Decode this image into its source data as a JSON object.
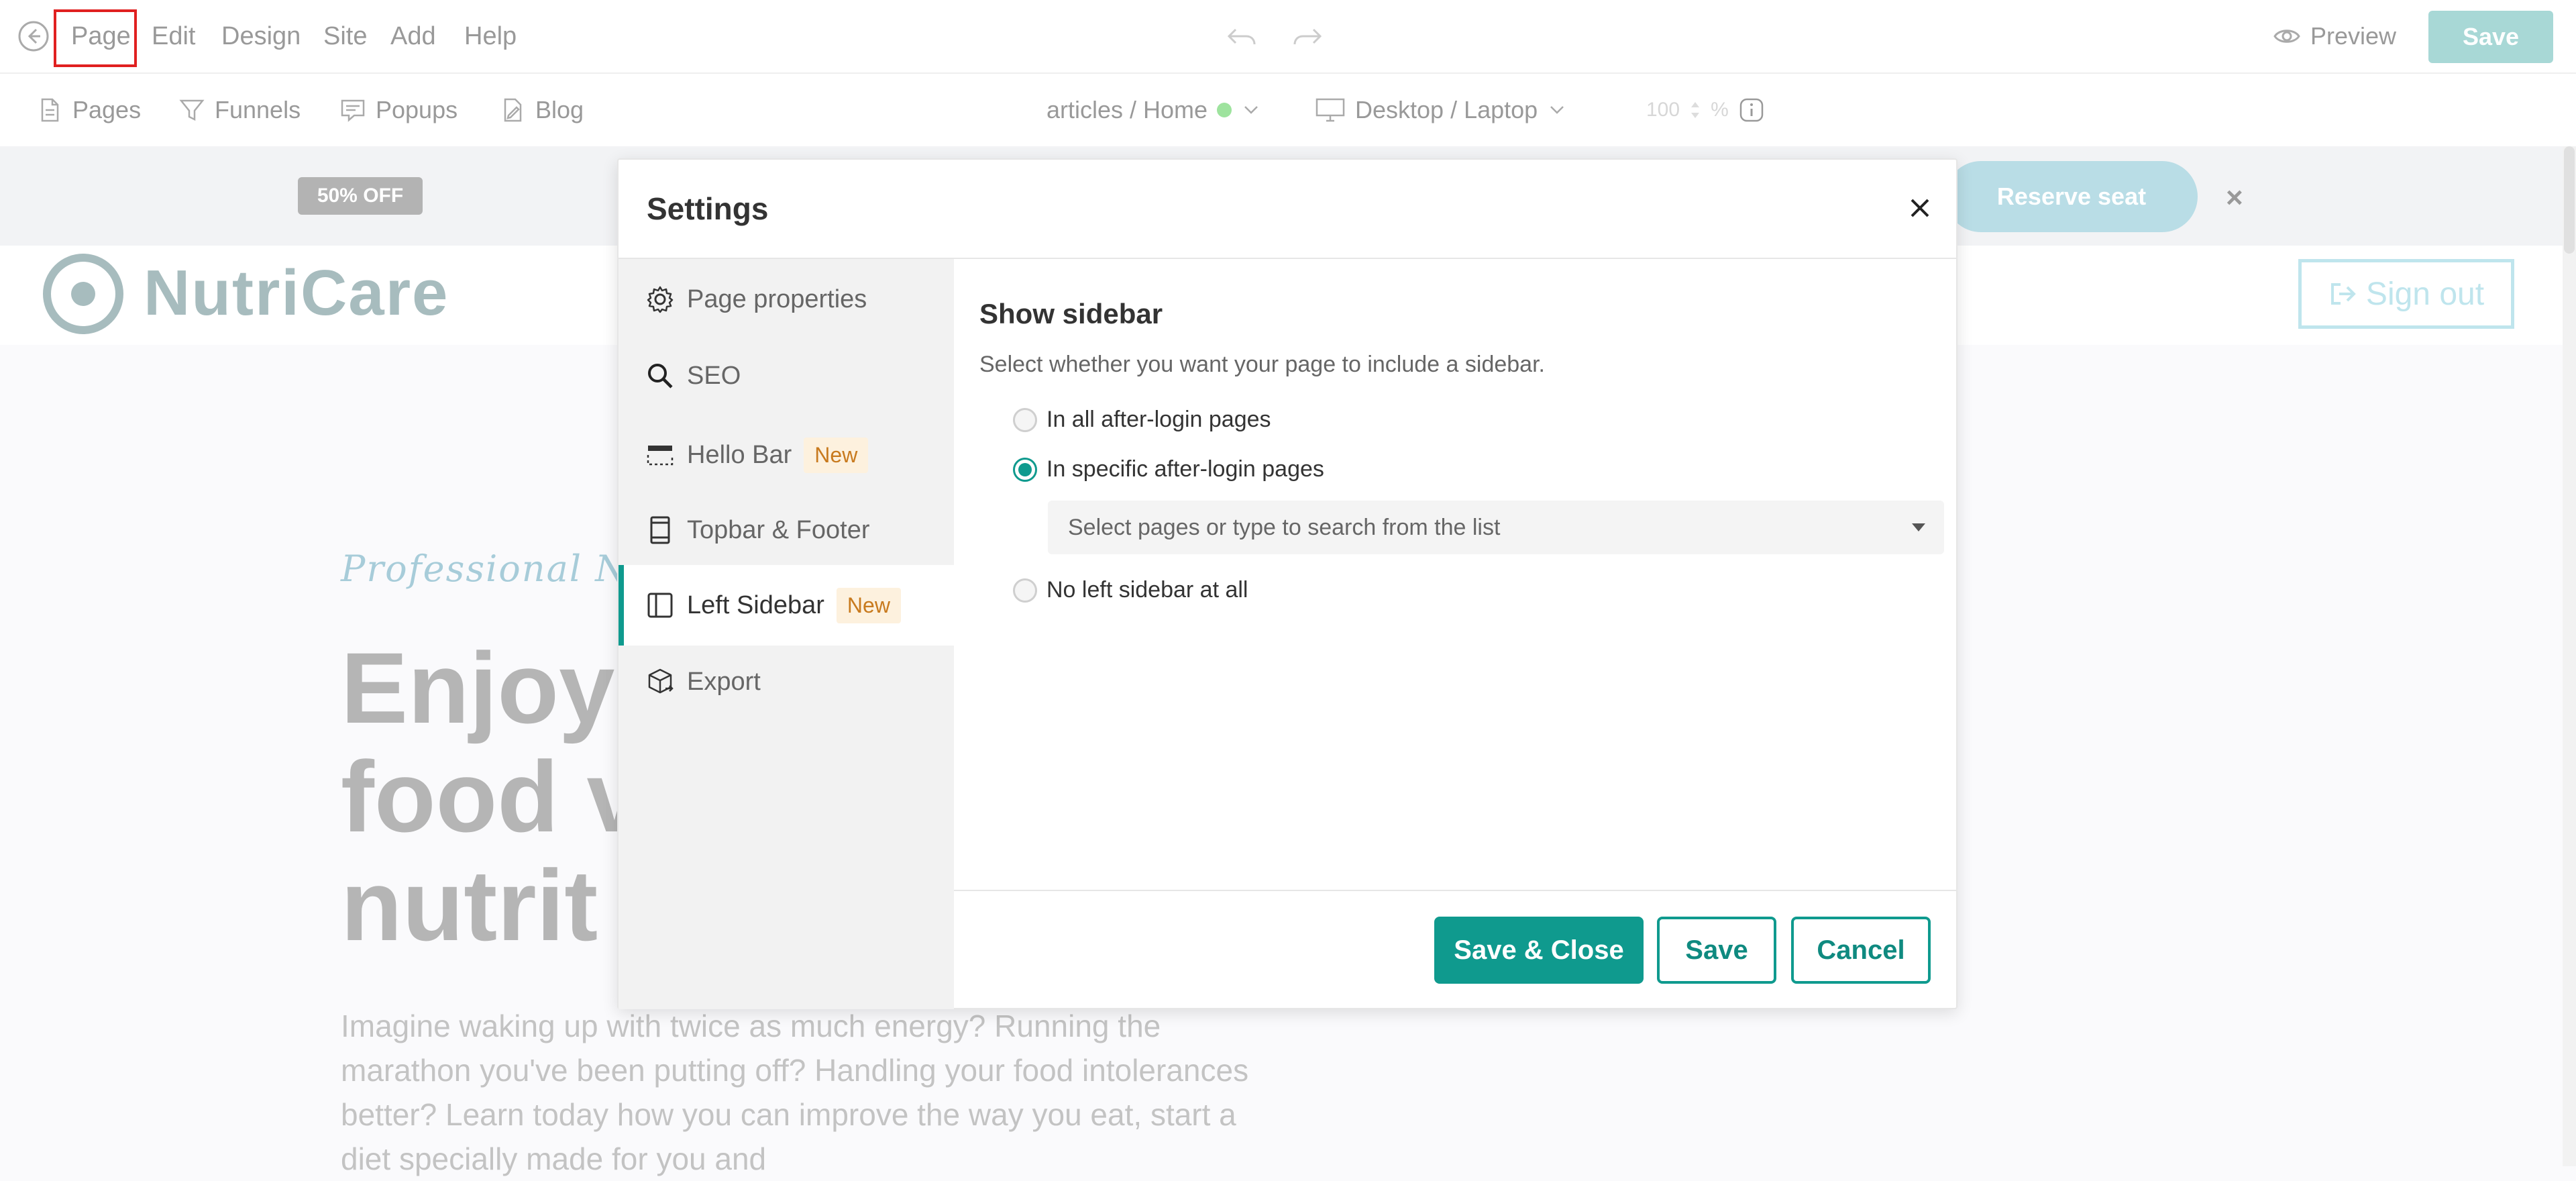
{
  "toolbar": {
    "menu": [
      "Page",
      "Edit",
      "Design",
      "Site",
      "Add",
      "Help"
    ],
    "preview_label": "Preview",
    "save_label": "Save"
  },
  "subbar": {
    "pages_label": "Pages",
    "funnels_label": "Funnels",
    "popups_label": "Popups",
    "blog_label": "Blog",
    "breadcrumb": "articles / Home",
    "device": "Desktop / Laptop",
    "zoom_value": "100",
    "zoom_unit": "%"
  },
  "background_page": {
    "hello_bar": {
      "badge": "50% OFF",
      "button": "Reserve seat",
      "close": "×"
    },
    "logo_text": "NutriCare",
    "signout_label": "Sign out",
    "hero_subtitle": "Professional Nu",
    "hero_title_lines": [
      "Enjoy",
      "food v",
      "nutrit"
    ],
    "hero_body": "Imagine waking up with twice as much energy? Running the marathon you've been putting off? Handling your food intolerances better? Learn today how you can improve the way you eat, start a diet specially made for you and"
  },
  "modal": {
    "title": "Settings",
    "nav": [
      {
        "label": "Page properties",
        "icon": "gear-icon"
      },
      {
        "label": "SEO",
        "icon": "search-icon"
      },
      {
        "label": "Hello Bar",
        "icon": "hello-bar-icon",
        "tag": "New"
      },
      {
        "label": "Topbar & Footer",
        "icon": "topbar-footer-icon"
      },
      {
        "label": "Left Sidebar",
        "icon": "sidebar-icon",
        "tag": "New",
        "active": true
      },
      {
        "label": "Export",
        "icon": "export-icon"
      }
    ],
    "section_title": "Show sidebar",
    "section_desc": "Select whether you want your page to include a sidebar.",
    "options": [
      {
        "label": "In all after-login pages",
        "checked": false
      },
      {
        "label": "In specific after-login pages",
        "checked": true
      },
      {
        "label": "No left sidebar at all",
        "checked": false
      }
    ],
    "select_placeholder": "Select pages or type to search from the list",
    "buttons": {
      "save_close": "Save & Close",
      "save": "Save",
      "cancel": "Cancel"
    }
  },
  "colors": {
    "accent": "#0f9a8e",
    "save_disabled": "#a8d8d6",
    "new_tag_bg": "#fdf1de",
    "new_tag_text": "#c87a1e",
    "status_dot": "#9ee39e",
    "highlight_box": "#e02020"
  }
}
